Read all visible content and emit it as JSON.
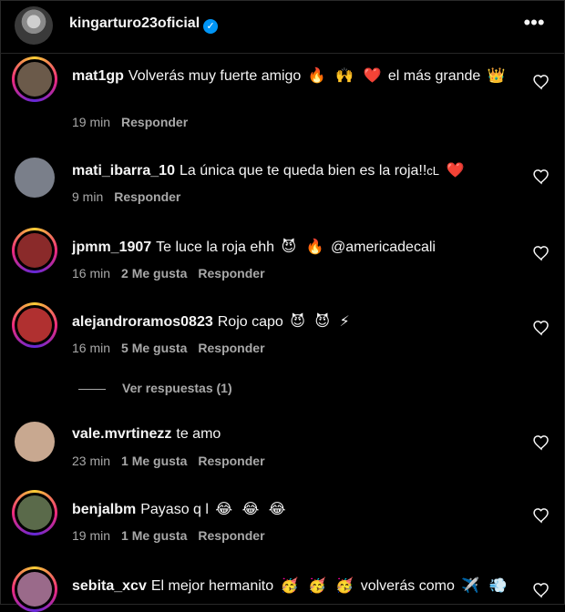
{
  "header": {
    "username": "kingarturo23oficial",
    "verified_icon": "verified-badge-icon",
    "more_label": "•••"
  },
  "comments": [
    {
      "user": "mat1gp",
      "text": "Volverás muy fuerte amigo",
      "emojis": [
        "🔥",
        "🙌",
        "❤️"
      ],
      "text2": "el más grande",
      "emojis2": [
        "👑"
      ],
      "time": "19 min",
      "likes": "",
      "reply": "Responder",
      "avatar_color": "#6b5a4a"
    },
    {
      "user": "mati_ibarra_10",
      "text": "La única que te queda bien es la roja!!",
      "suffix": "cL",
      "emojis": [
        "❤️"
      ],
      "time": "9 min",
      "likes": "",
      "reply": "Responder",
      "avatar_color": "#7a7f8a"
    },
    {
      "user": "jpmm_1907",
      "text": "Te luce la roja ehh",
      "emojis": [
        "😈",
        "🔥"
      ],
      "mention": "@americadecali",
      "time": "16 min",
      "likes": "2 Me gusta",
      "reply": "Responder",
      "avatar_color": "#8a2a2a"
    },
    {
      "user": "alejandroramos0823",
      "text": "Rojo capo",
      "emojis": [
        "😈",
        "😈",
        "⚡"
      ],
      "time": "16 min",
      "likes": "5 Me gusta",
      "reply": "Responder",
      "avatar_color": "#b03030"
    },
    {
      "user": "vale.mvrtinezz",
      "text": "te amo",
      "emojis": [],
      "time": "23 min",
      "likes": "1 Me gusta",
      "reply": "Responder",
      "avatar_color": "#c8a890"
    },
    {
      "user": "benjalbm",
      "text": "Payaso q l",
      "emojis": [
        "😂",
        "😂",
        "😂"
      ],
      "time": "19 min",
      "likes": "1 Me gusta",
      "reply": "Responder",
      "avatar_color": "#5a6a4a"
    },
    {
      "user": "sebita_xcv",
      "text": "El mejor hermanito",
      "emojis": [
        "🥳",
        "🥳",
        "🥳"
      ],
      "text2": "volverás como",
      "emojis2": [
        "✈️",
        "💨"
      ],
      "time": "",
      "likes": "",
      "reply": "",
      "avatar_color": "#9a6a8a"
    }
  ],
  "replies_label": "Ver respuestas (1)",
  "colors": {
    "background": "#000000",
    "secondary_text": "#a8a8a8",
    "verified": "#0095f6"
  }
}
